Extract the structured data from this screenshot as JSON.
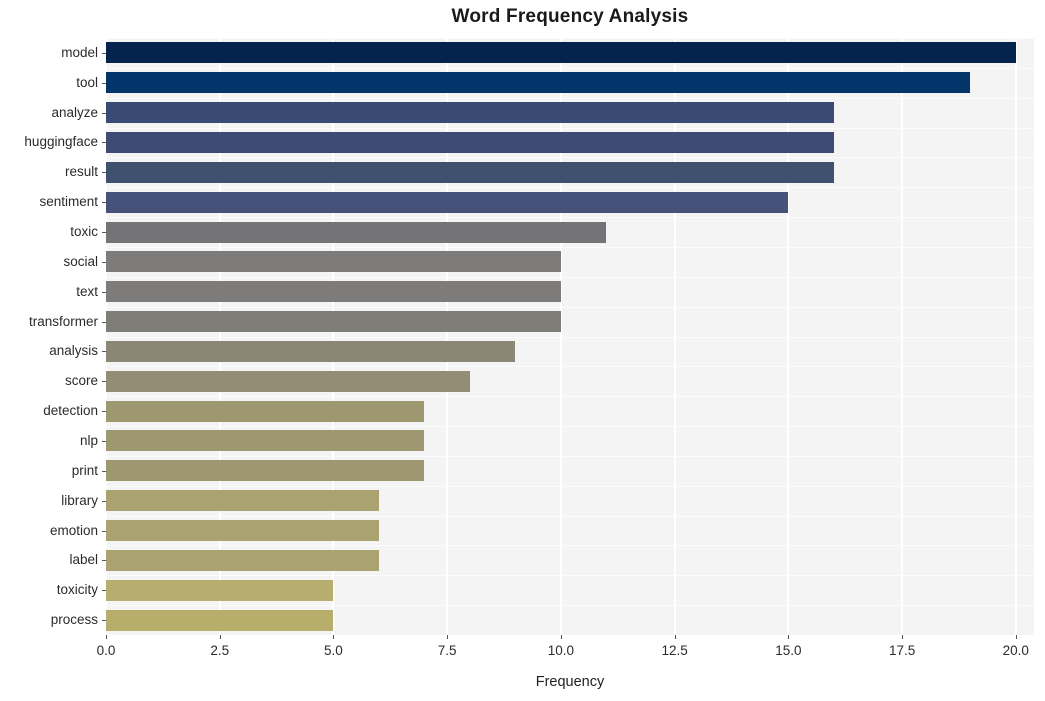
{
  "chart_data": {
    "type": "bar",
    "orientation": "horizontal",
    "title": "Word Frequency Analysis",
    "xlabel": "Frequency",
    "ylabel": "",
    "xlim": [
      0,
      20.4
    ],
    "grid": true,
    "legend": null,
    "categories": [
      "model",
      "tool",
      "analyze",
      "huggingface",
      "result",
      "sentiment",
      "toxic",
      "social",
      "text",
      "transformer",
      "analysis",
      "score",
      "detection",
      "nlp",
      "print",
      "library",
      "emotion",
      "label",
      "toxicity",
      "process"
    ],
    "values": [
      20,
      19,
      16,
      16,
      16,
      15,
      11,
      10,
      10,
      10,
      9,
      8,
      7,
      7,
      7,
      6,
      6,
      6,
      5,
      5
    ],
    "bar_colors": [
      "#05244d",
      "#03356b",
      "#3b4a72",
      "#3e4c73",
      "#40506f",
      "#46527a",
      "#747477",
      "#7d7c7a",
      "#7d7c7a",
      "#7e7d78",
      "#8a8776",
      "#928d74",
      "#9e9871",
      "#9e9871",
      "#9e9871",
      "#aaa271",
      "#aaa271",
      "#aaa271",
      "#b7ad6e",
      "#b8ae6c"
    ],
    "xticks": [
      "0.0",
      "2.5",
      "5.0",
      "7.5",
      "10.0",
      "12.5",
      "15.0",
      "17.5",
      "20.0"
    ],
    "xtick_values": [
      0,
      2.5,
      5,
      7.5,
      10,
      12.5,
      15,
      17.5,
      20
    ],
    "plot_background": "#f4f4f5",
    "gridline_color": "#ffffff",
    "figure_background": "#ffffff"
  }
}
